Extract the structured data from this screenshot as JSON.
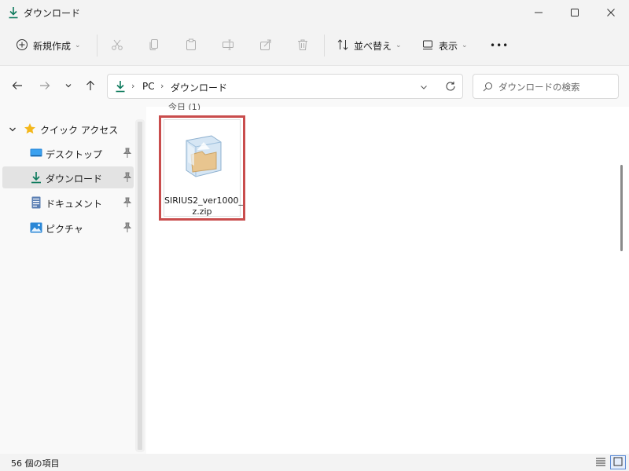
{
  "window": {
    "title": "ダウンロード"
  },
  "toolbar": {
    "new_label": "新規作成",
    "sort_label": "並べ替え",
    "view_label": "表示",
    "more_label": "•••"
  },
  "address": {
    "crumbs": [
      "PC",
      "ダウンロード"
    ],
    "search_placeholder": "ダウンロードの検索"
  },
  "sidebar": {
    "quick_access": "クイック アクセス",
    "items": [
      {
        "label": "デスクトップ"
      },
      {
        "label": "ダウンロード"
      },
      {
        "label": "ドキュメント"
      },
      {
        "label": "ピクチャ"
      }
    ]
  },
  "content": {
    "group_header": "今日 (1)",
    "files": [
      {
        "name_line1": "SIRIUS2_ver1000_",
        "name_line2": "z.zip"
      }
    ]
  },
  "status": {
    "item_count": "56 個の項目"
  },
  "colors": {
    "accent": "#0f7b5e",
    "highlight": "#c94d4d",
    "star": "#f4b71b"
  }
}
